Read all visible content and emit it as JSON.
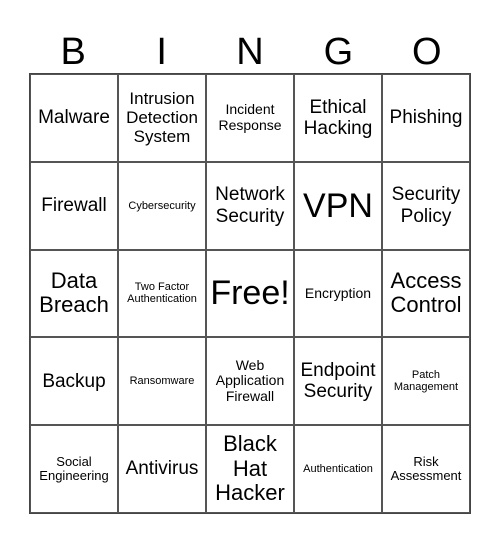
{
  "header": [
    "B",
    "I",
    "N",
    "G",
    "O"
  ],
  "cells": [
    {
      "text": "Malware",
      "size": "s6"
    },
    {
      "text": "Intrusion Detection System",
      "size": "s5"
    },
    {
      "text": "Incident Response",
      "size": "s4"
    },
    {
      "text": "Ethical Hacking",
      "size": "s6"
    },
    {
      "text": "Phishing",
      "size": "s6"
    },
    {
      "text": "Firewall",
      "size": "s6"
    },
    {
      "text": "Cybersecurity",
      "size": "s1"
    },
    {
      "text": "Network Security",
      "size": "s6"
    },
    {
      "text": "VPN",
      "size": "s8"
    },
    {
      "text": "Security Policy",
      "size": "s6"
    },
    {
      "text": "Data Breach",
      "size": "s7"
    },
    {
      "text": "Two Factor Authentication",
      "size": "s1"
    },
    {
      "text": "Free!",
      "size": "s8"
    },
    {
      "text": "Encryption",
      "size": "s4"
    },
    {
      "text": "Access Control",
      "size": "s7"
    },
    {
      "text": "Backup",
      "size": "s6"
    },
    {
      "text": "Ransomware",
      "size": "s1"
    },
    {
      "text": "Web Application Firewall",
      "size": "s4"
    },
    {
      "text": "Endpoint Security",
      "size": "s6"
    },
    {
      "text": "Patch Management",
      "size": "s1"
    },
    {
      "text": "Social Engineering",
      "size": "s3"
    },
    {
      "text": "Antivirus",
      "size": "s6"
    },
    {
      "text": "Black Hat Hacker",
      "size": "s7"
    },
    {
      "text": "Authentication",
      "size": "s1"
    },
    {
      "text": "Risk Assessment",
      "size": "s3"
    }
  ]
}
